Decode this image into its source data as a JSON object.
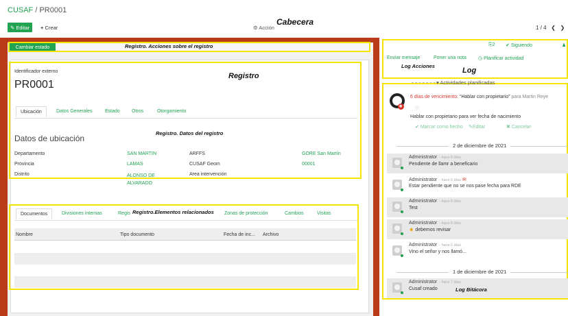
{
  "header": {
    "crumb_root": "CUSAF",
    "crumb_sep": " / ",
    "crumb_current": "PR0001",
    "edit": "Editar",
    "create": "Crear",
    "action": "Acción",
    "pager": "1 / 4",
    "annotation": "Cabecera"
  },
  "statusbar": {
    "change_state": "Cambiar estado",
    "annotation": "Registro. Acciones sobre el registro"
  },
  "record": {
    "ext_id_label": "Identificador externo",
    "title": "PR0001",
    "annotation": "Registro",
    "tabs": [
      "Ubicación",
      "Datos Generales",
      "Estado",
      "Otros",
      "Otorgamiento"
    ],
    "section": "Datos de ubicación",
    "section_annotation": "Registro. Datos del registro",
    "rows": [
      {
        "label": "Departamento",
        "value": "SAN MARTIN",
        "label2": "ARFFS",
        "value2": "GORE San Martín"
      },
      {
        "label": "Provincia",
        "value": "LAMAS",
        "label2": "CUSAF Geom",
        "value2": "00001"
      },
      {
        "label": "Distrito",
        "value": "ALONSO DE ALVARADO",
        "label2": "Area intervención",
        "value2": ""
      }
    ]
  },
  "related": {
    "annotation": "Registro.Elementos relacionados",
    "tabs": [
      "Documentos",
      "Divisiones internas",
      "Regis",
      "Zonas de protección",
      "Cambios",
      "Visitas"
    ],
    "columns": [
      "Nombre",
      "Tipo documento",
      "Fecha de inc...",
      "Archivo"
    ]
  },
  "chatter": {
    "followers": "2",
    "following": "Siguiendo",
    "followers_icon": "person-icon",
    "send": "Enviar mensaje",
    "note": "Poner una nota",
    "plan": "Planificar actividad",
    "log_actions": "Log Acciones",
    "log": "Log",
    "planned": "Actividades planificadas",
    "due": "6 días de vencimiento:",
    "act_title": "“Hablar con propietario”",
    "for": "para Martin Reye",
    "act_desc": "Hablar con propietario para ver fecha de nacimiento",
    "done": "Marcar como hecho",
    "edit": "Editar",
    "cancel": "Cancelar",
    "date1": "2 de diciembre de 2021",
    "date2": "1 de diciembre de 2021",
    "bitacora": "Log Bitácora",
    "messages": [
      {
        "author": "Administrator",
        "ago": "- hace 6 días",
        "body": "Pendiente de llamr a beneficario"
      },
      {
        "author": "Administrator",
        "ago": "- hace 6 días",
        "body": "Estar pendiente que no se nos pase fecha para RDE"
      },
      {
        "author": "Administrator",
        "ago": "- hace 6 días",
        "body": "Test"
      },
      {
        "author": "Administrator",
        "ago": "- hace 6 días",
        "body": "debemos revisar"
      },
      {
        "author": "Administrator",
        "ago": "- hace 6 días",
        "body": "Vino el señor y nos llamó..."
      },
      {
        "author": "Administrator",
        "ago": "- hace 7 días",
        "body": "Cusaf creado"
      }
    ]
  }
}
